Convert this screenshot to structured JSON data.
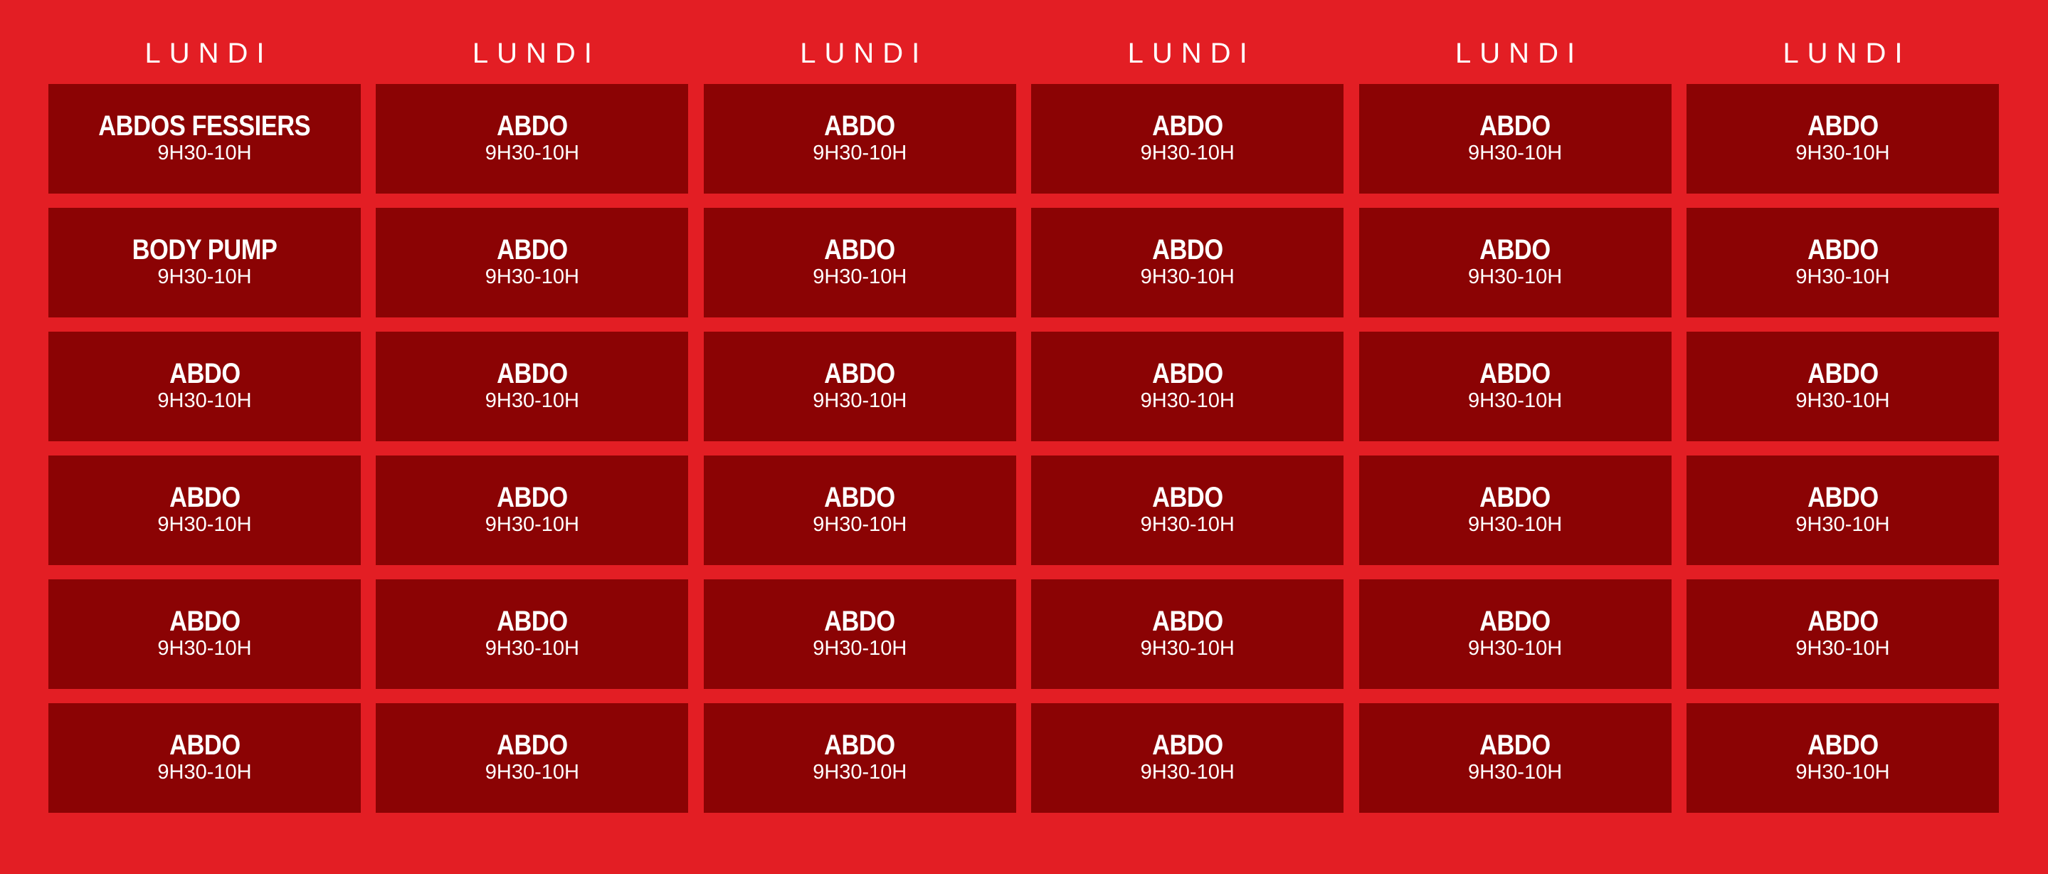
{
  "colors": {
    "background": "#e31e24",
    "cell": "#8b0304",
    "text": "#ffffff"
  },
  "days": [
    "LUNDI",
    "LUNDI",
    "LUNDI",
    "LUNDI",
    "LUNDI",
    "LUNDI"
  ],
  "rows": [
    [
      {
        "name": "ABDOS FESSIERS",
        "time": "9H30-10H"
      },
      {
        "name": "ABDO",
        "time": "9H30-10H"
      },
      {
        "name": "ABDO",
        "time": "9H30-10H"
      },
      {
        "name": "ABDO",
        "time": "9H30-10H"
      },
      {
        "name": "ABDO",
        "time": "9H30-10H"
      },
      {
        "name": "ABDO",
        "time": "9H30-10H"
      }
    ],
    [
      {
        "name": "BODY PUMP",
        "time": "9H30-10H"
      },
      {
        "name": "ABDO",
        "time": "9H30-10H"
      },
      {
        "name": "ABDO",
        "time": "9H30-10H"
      },
      {
        "name": "ABDO",
        "time": "9H30-10H"
      },
      {
        "name": "ABDO",
        "time": "9H30-10H"
      },
      {
        "name": "ABDO",
        "time": "9H30-10H"
      }
    ],
    [
      {
        "name": "ABDO",
        "time": "9H30-10H"
      },
      {
        "name": "ABDO",
        "time": "9H30-10H"
      },
      {
        "name": "ABDO",
        "time": "9H30-10H"
      },
      {
        "name": "ABDO",
        "time": "9H30-10H"
      },
      {
        "name": "ABDO",
        "time": "9H30-10H"
      },
      {
        "name": "ABDO",
        "time": "9H30-10H"
      }
    ],
    [
      {
        "name": "ABDO",
        "time": "9H30-10H"
      },
      {
        "name": "ABDO",
        "time": "9H30-10H"
      },
      {
        "name": "ABDO",
        "time": "9H30-10H"
      },
      {
        "name": "ABDO",
        "time": "9H30-10H"
      },
      {
        "name": "ABDO",
        "time": "9H30-10H"
      },
      {
        "name": "ABDO",
        "time": "9H30-10H"
      }
    ],
    [
      {
        "name": "ABDO",
        "time": "9H30-10H"
      },
      {
        "name": "ABDO",
        "time": "9H30-10H"
      },
      {
        "name": "ABDO",
        "time": "9H30-10H"
      },
      {
        "name": "ABDO",
        "time": "9H30-10H"
      },
      {
        "name": "ABDO",
        "time": "9H30-10H"
      },
      {
        "name": "ABDO",
        "time": "9H30-10H"
      }
    ],
    [
      {
        "name": "ABDO",
        "time": "9H30-10H"
      },
      {
        "name": "ABDO",
        "time": "9H30-10H"
      },
      {
        "name": "ABDO",
        "time": "9H30-10H"
      },
      {
        "name": "ABDO",
        "time": "9H30-10H"
      },
      {
        "name": "ABDO",
        "time": "9H30-10H"
      },
      {
        "name": "ABDO",
        "time": "9H30-10H"
      }
    ]
  ]
}
